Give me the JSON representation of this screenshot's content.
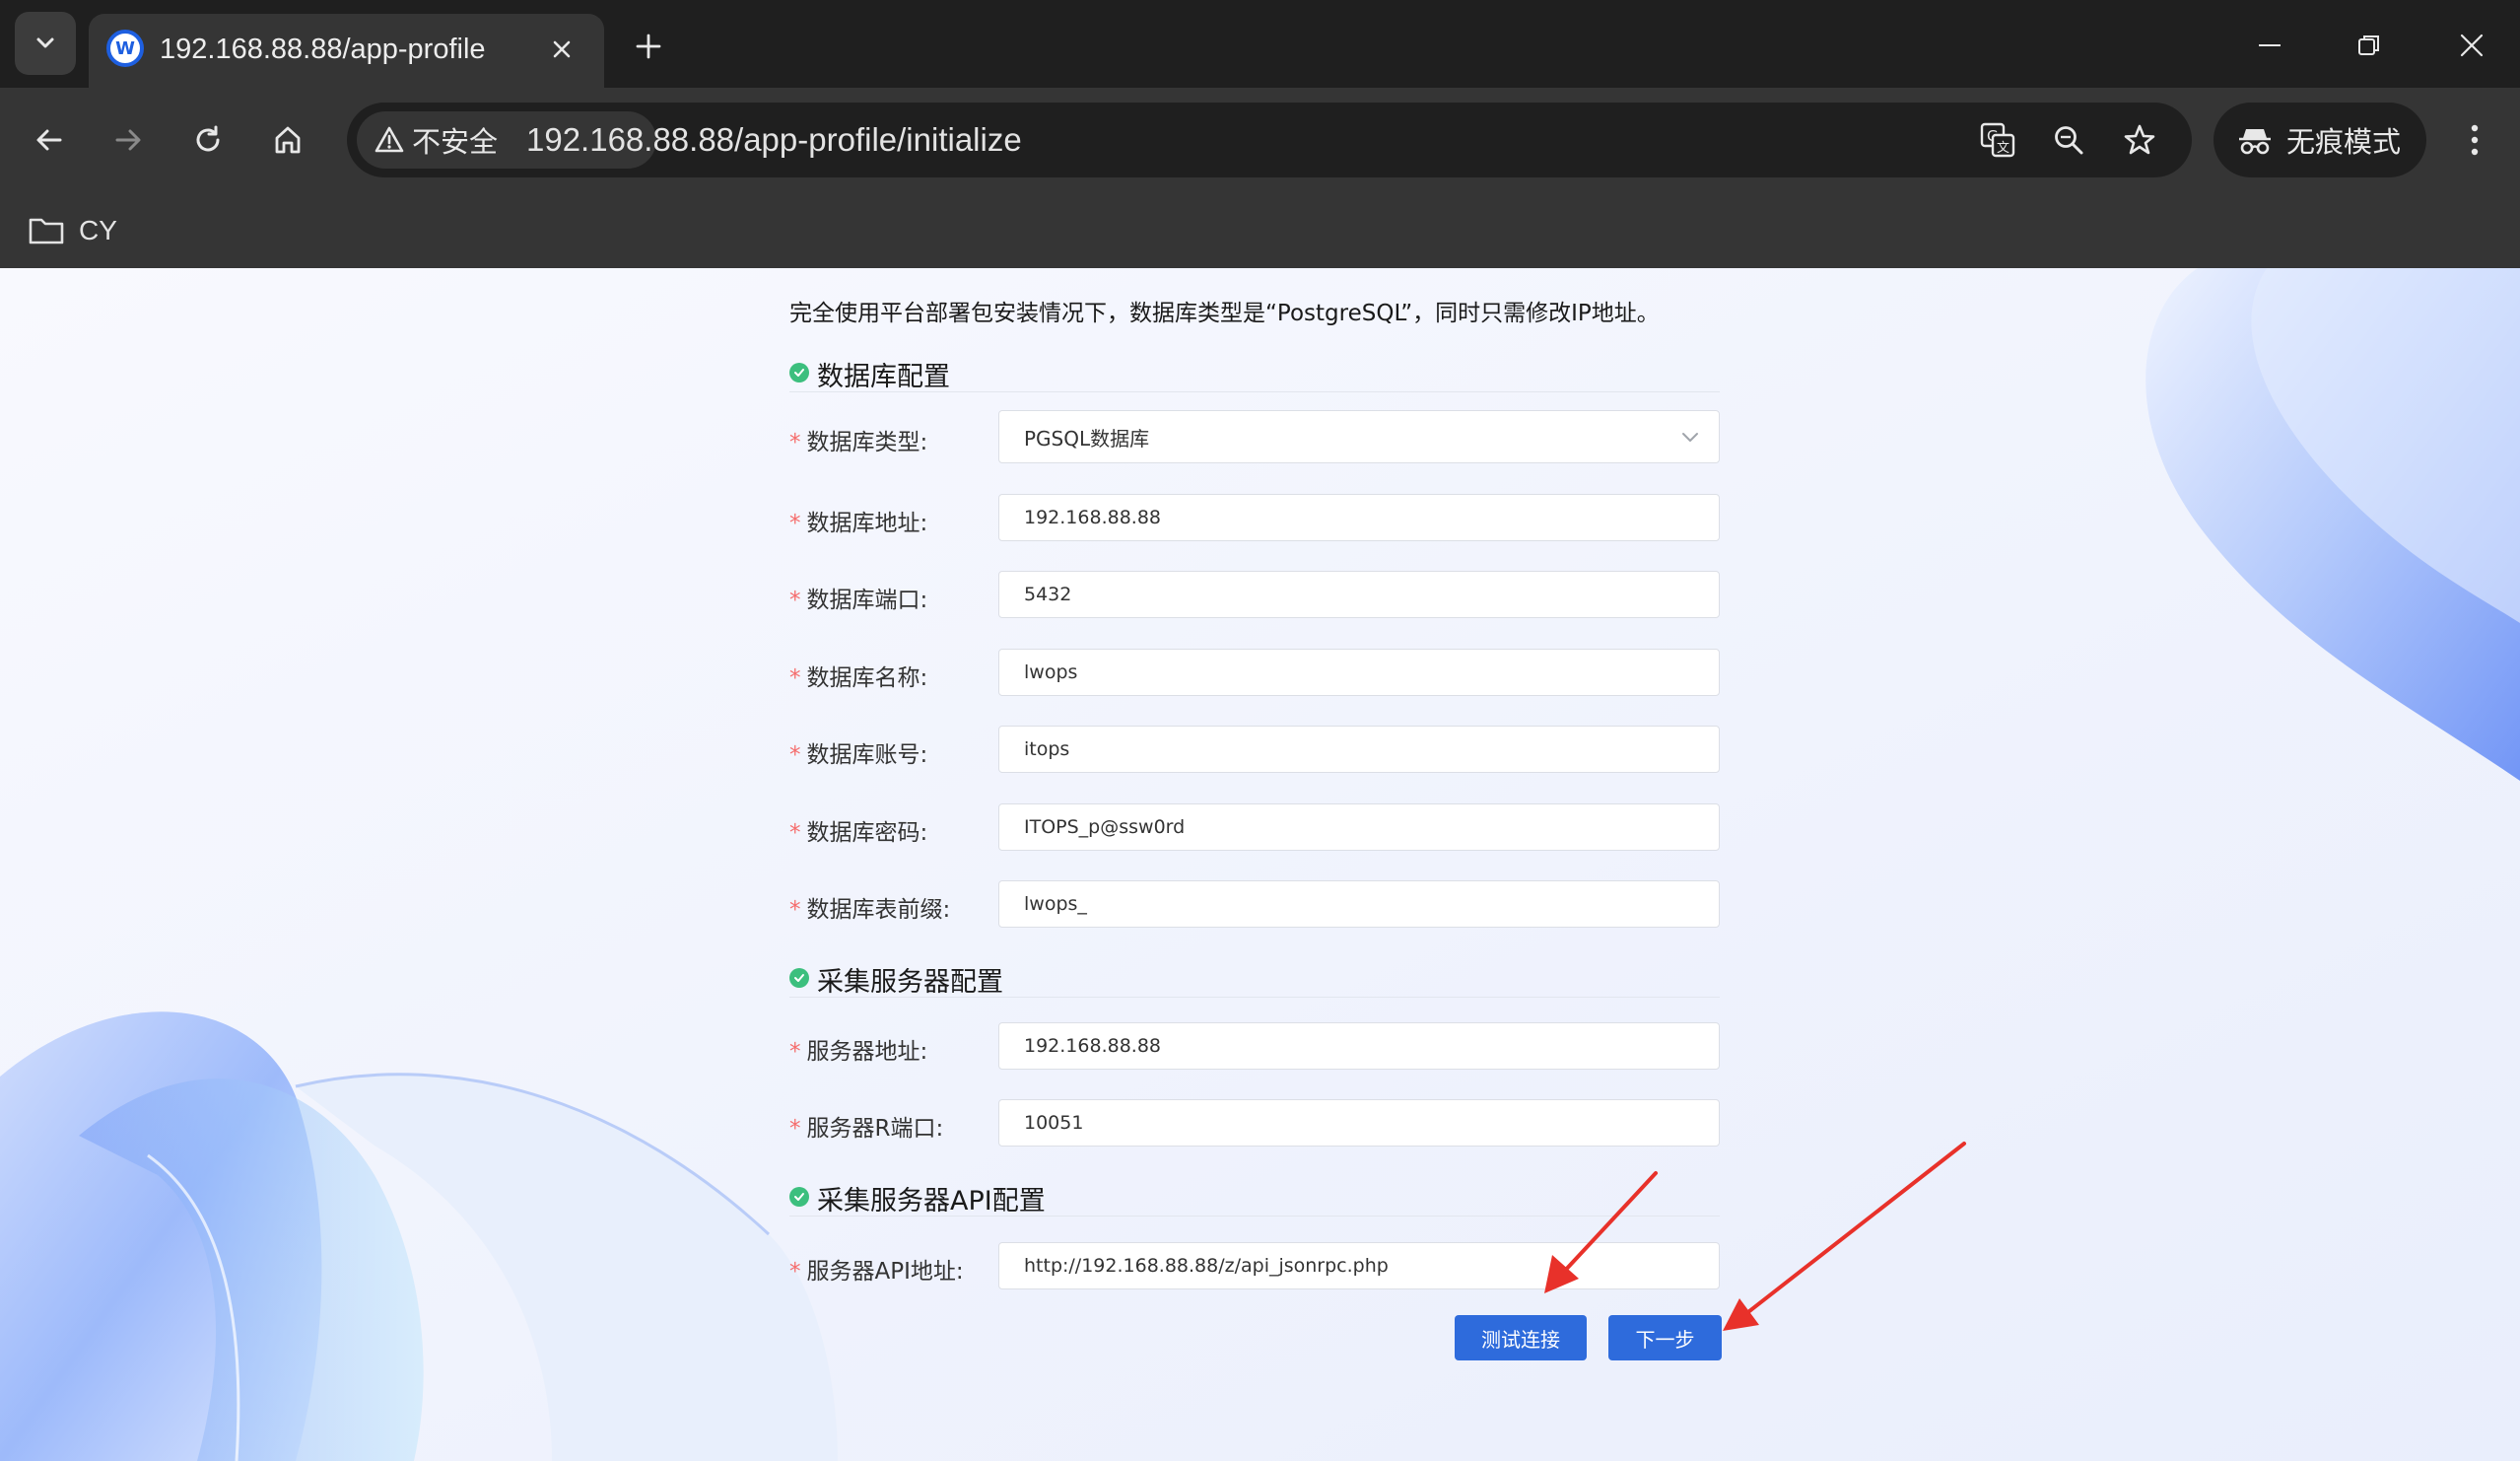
{
  "browser": {
    "tab": {
      "title": "192.168.88.88/app-profile",
      "favicon": "w-logo-icon"
    },
    "url": "192.168.88.88/app-profile/initialize",
    "security_label": "不安全",
    "incognito_label": "无痕模式",
    "bookmarks": [
      {
        "label": "CY",
        "icon": "folder-icon"
      }
    ]
  },
  "page": {
    "intro": "完全使用平台部署包安装情况下，数据库类型是“PostgreSQL”，同时只需修改IP地址。",
    "required_mark": "*",
    "sections": {
      "database": {
        "title": "数据库配置",
        "type_label": "数据库类型:",
        "type_value": "PGSQL数据库",
        "host_label": "数据库地址:",
        "host_value": "192.168.88.88",
        "port_label": "数据库端口:",
        "port_value": "5432",
        "name_label": "数据库名称:",
        "name_value": "lwops",
        "user_label": "数据库账号:",
        "user_value": "itops",
        "password_label": "数据库密码:",
        "password_value": "ITOPS_p@ssw0rd",
        "prefix_label": "数据库表前缀:",
        "prefix_value": "lwops_"
      },
      "collector": {
        "title": "采集服务器配置",
        "host_label": "服务器地址:",
        "host_value": "192.168.88.88",
        "port_label": "服务器R端口:",
        "port_value": "10051"
      },
      "api": {
        "title": "采集服务器API配置",
        "url_label": "服务器API地址:",
        "url_value": "http://192.168.88.88/z/api_jsonrpc.php"
      }
    },
    "buttons": {
      "test": "测试连接",
      "next": "下一步"
    }
  },
  "colors": {
    "accent": "#2e6bdc",
    "success": "#3cbf7e",
    "required": "#f56c6c",
    "annotation_arrow": "#e8312a"
  }
}
